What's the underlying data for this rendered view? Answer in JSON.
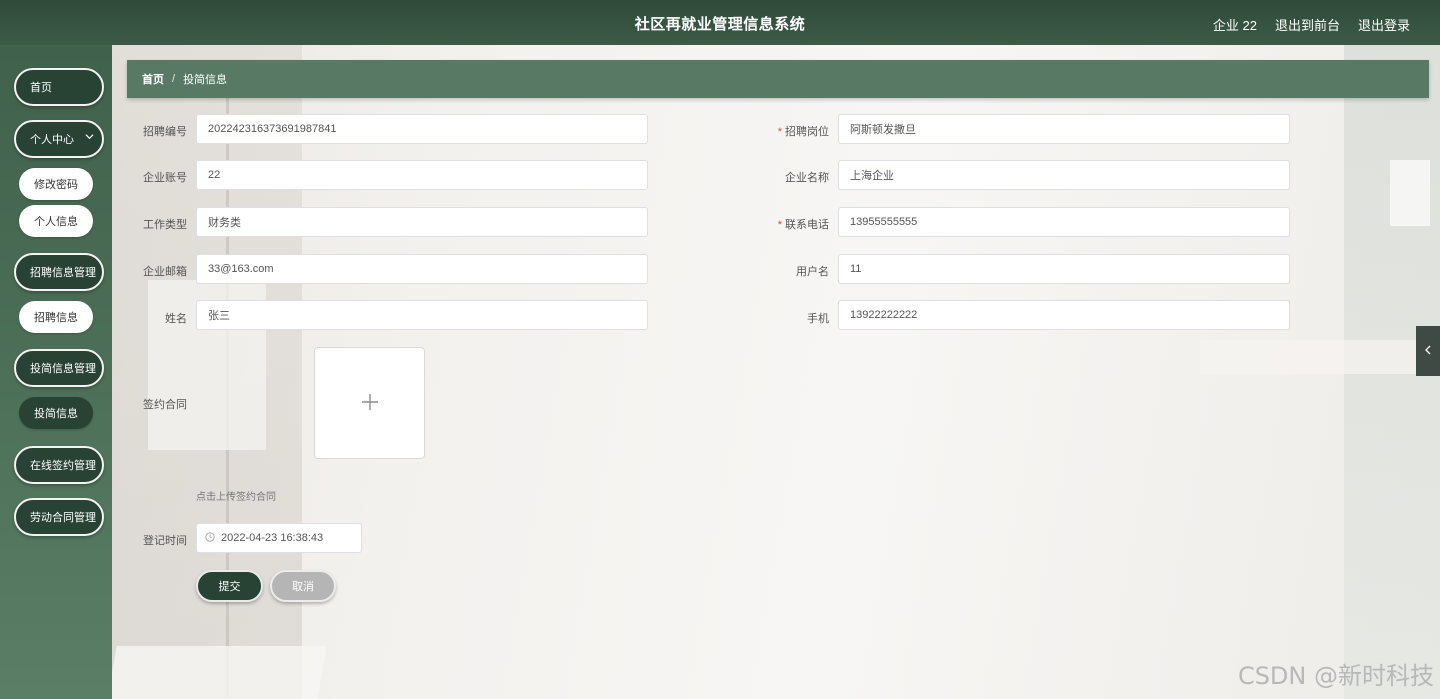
{
  "header": {
    "title": "社区再就业管理信息系统",
    "user": "企业 22",
    "front_link": "退出到前台",
    "logout_link": "退出登录"
  },
  "sidebar": {
    "home": "首页",
    "personal_center": "个人中心",
    "change_password": "修改密码",
    "personal_info": "个人信息",
    "recruit_mgmt": "招聘信息管理",
    "recruit_info": "招聘信息",
    "resume_mgmt": "投简信息管理",
    "resume_info": "投简信息",
    "online_sign_mgmt": "在线签约管理",
    "labor_contract_mgmt": "劳动合同管理"
  },
  "breadcrumb": {
    "home": "首页",
    "separator": "/",
    "current": "投简信息"
  },
  "form": {
    "recruit_no": {
      "label": "招聘编号",
      "value": "202242316373691987841"
    },
    "recruit_post": {
      "label": "招聘岗位",
      "value": "阿斯顿发撒旦"
    },
    "company_account": {
      "label": "企业账号",
      "value": "22"
    },
    "company_name": {
      "label": "企业名称",
      "value": "上海企业"
    },
    "job_type": {
      "label": "工作类型",
      "value": "财务类"
    },
    "contact_phone": {
      "label": "联系电话",
      "value": "13955555555"
    },
    "company_email": {
      "label": "企业邮箱",
      "value": "33@163.com"
    },
    "username": {
      "label": "用户名",
      "value": "11"
    },
    "name": {
      "label": "姓名",
      "value": "张三"
    },
    "mobile": {
      "label": "手机",
      "value": "13922222222"
    },
    "contract": {
      "label": "签约合同",
      "hint": "点击上传签约合同"
    },
    "register_time": {
      "label": "登记时间",
      "value": "2022-04-23 16:38:43"
    },
    "required_mark": "*",
    "submit": "提交",
    "cancel": "取消"
  },
  "watermark": "CSDN @新时科技",
  "colors": {
    "header": "#34503f",
    "sidebar": "#4c6e57",
    "accent": "#284234",
    "breadcrumb": "#587a65"
  }
}
